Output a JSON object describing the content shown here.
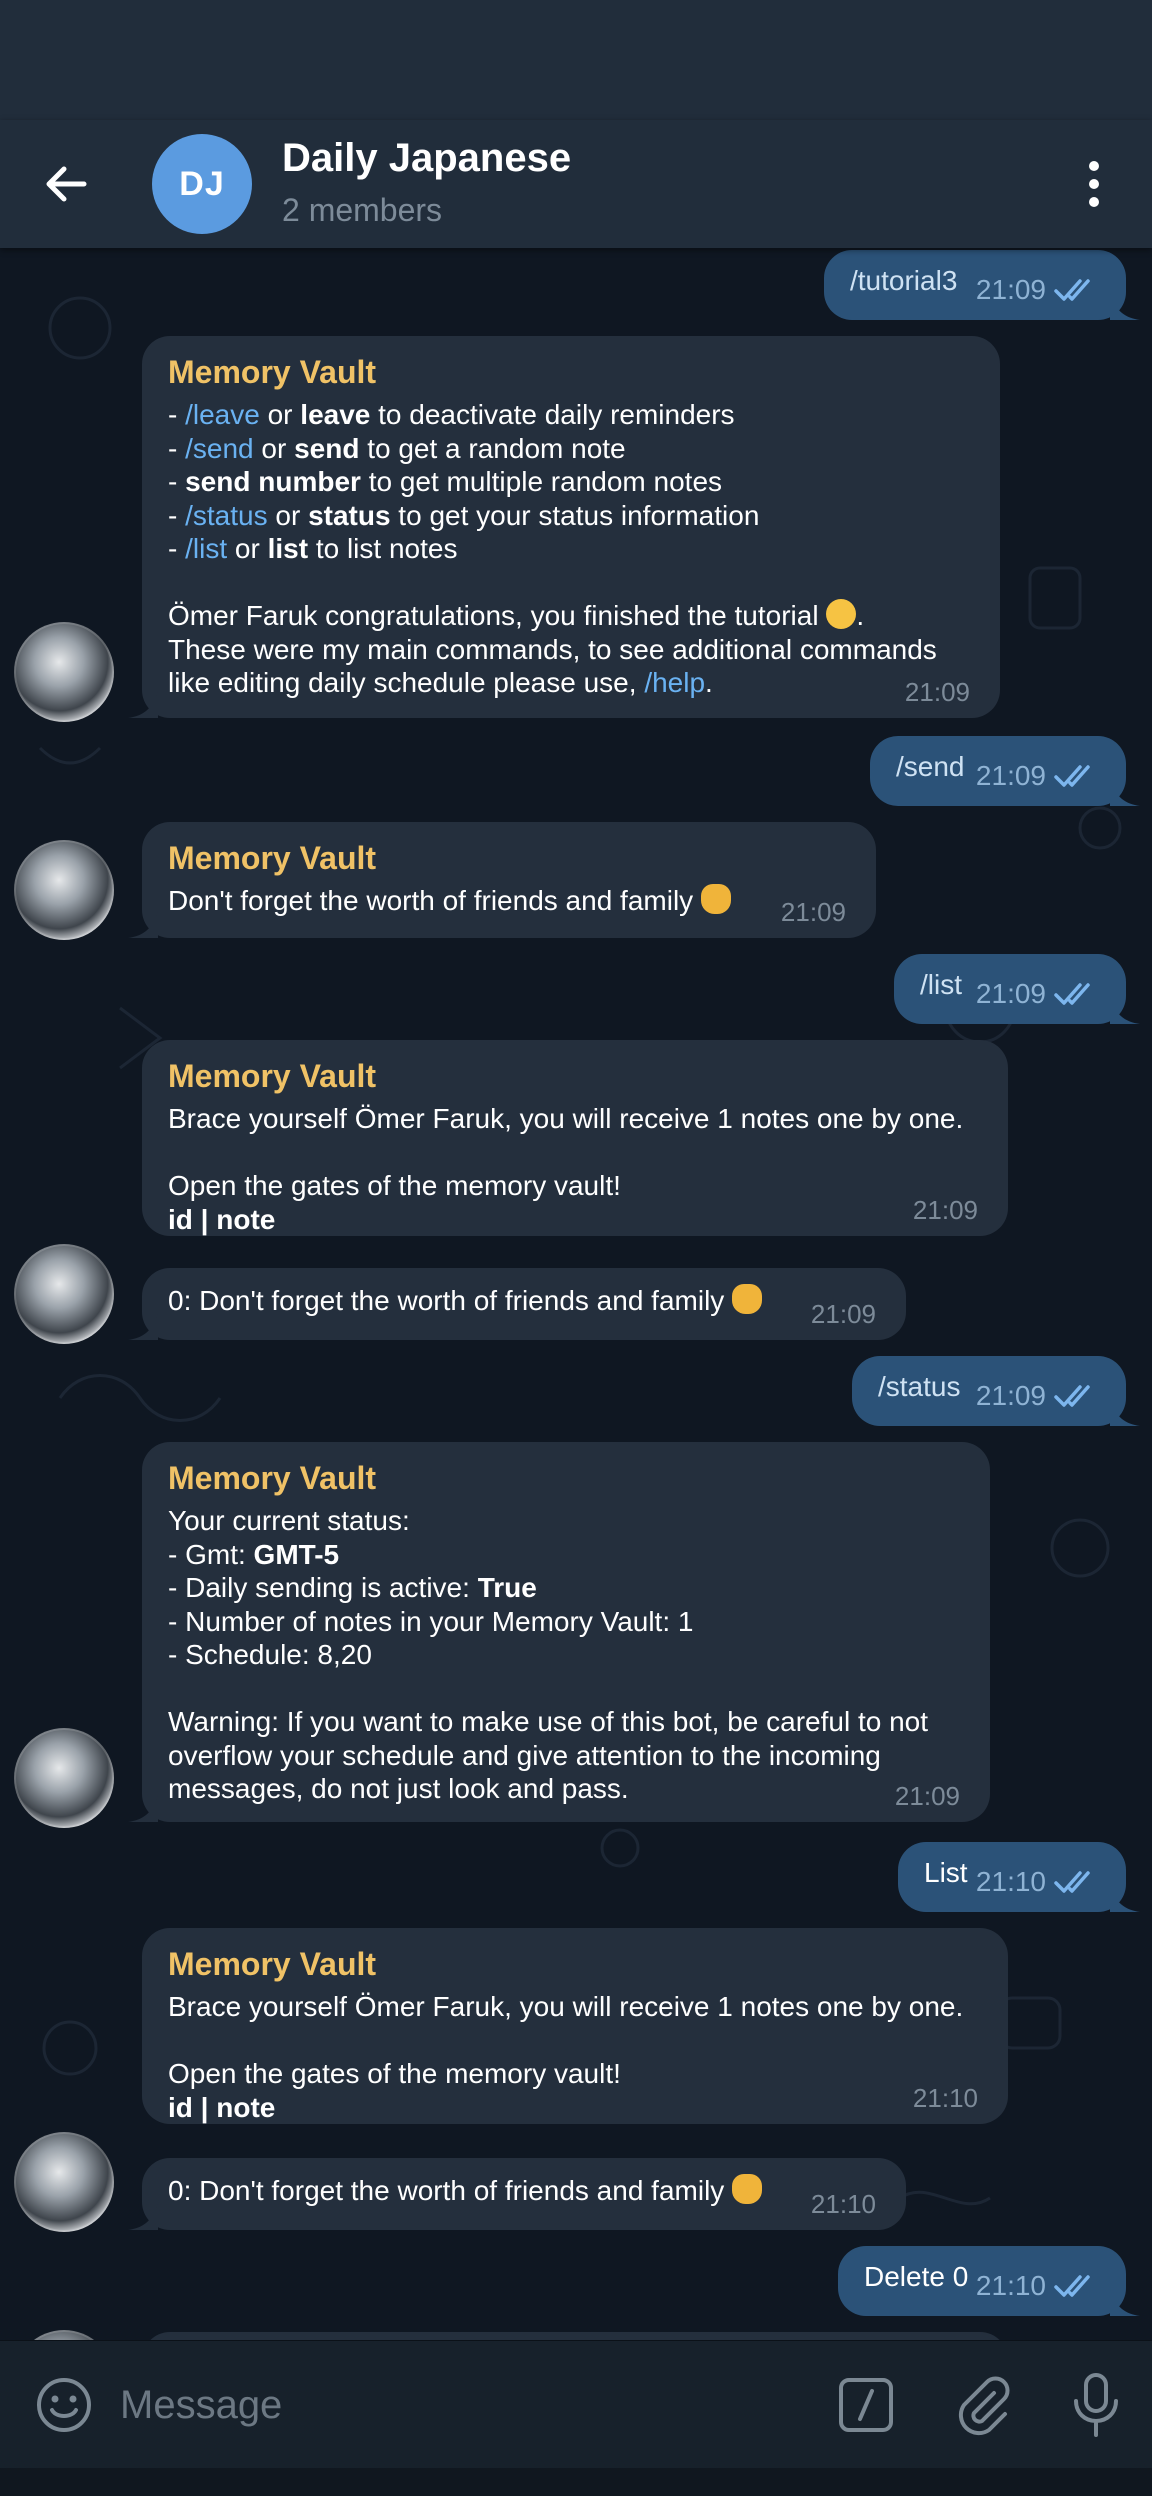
{
  "header": {
    "avatar_initials": "DJ",
    "title": "Daily Japanese",
    "subtitle": "2 members",
    "back_icon": "arrow-left-icon",
    "menu_icon": "more-vertical-icon"
  },
  "messages": [
    {
      "type": "out",
      "text": "/tutorial3",
      "time": "21:09"
    },
    {
      "type": "in",
      "sender": "Memory Vault",
      "time": "21:09",
      "lines": {
        "l1a": "- ",
        "l1b": "/leave",
        "l1c": " or ",
        "l1d": "leave",
        "l1e": " to deactivate daily reminders",
        "l2a": "- ",
        "l2b": "/send",
        "l2c": " or ",
        "l2d": "send",
        "l2e": " to get a random note",
        "l3a": "- ",
        "l3b": "send number",
        "l3c": " to get multiple random notes",
        "l4a": "- ",
        "l4b": "/status",
        "l4c": " or ",
        "l4d": "status",
        "l4e": " to get your status information",
        "l5a": "- ",
        "l5b": "/list",
        "l5c": " or ",
        "l5d": "list",
        "l5e": " to list notes",
        "p2a": "Ömer Faruk congratulations, you finished the tutorial ",
        "p2b": ".",
        "p3a": "These were my main commands, to see additional commands",
        "p3b": "like editing daily schedule please use, ",
        "p3c": "/help",
        "p3d": "."
      }
    },
    {
      "type": "out",
      "text": "/send",
      "time": "21:09"
    },
    {
      "type": "in",
      "sender": "Memory Vault",
      "text": "Don't forget the worth of friends and family ",
      "time": "21:09"
    },
    {
      "type": "out",
      "text": "/list",
      "time": "21:09"
    },
    {
      "type": "in",
      "sender": "Memory Vault",
      "time": "21:09",
      "lines": {
        "a": "Brace yourself Ömer Faruk, you will receive 1 notes one by one.",
        "b": "Open the gates of the memory vault!",
        "c": "id | note"
      }
    },
    {
      "type": "in",
      "text": "0: Don't forget the worth of friends and family ",
      "time": "21:09"
    },
    {
      "type": "out",
      "text": "/status",
      "time": "21:09"
    },
    {
      "type": "in",
      "sender": "Memory Vault",
      "time": "21:09",
      "lines": {
        "a": "Your current status:",
        "b1": "- Gmt: ",
        "b2": "GMT-5",
        "c1": "- Daily sending is active: ",
        "c2": "True",
        "d": "- Number of notes in your Memory Vault: 1",
        "e": "- Schedule: 8,20",
        "f": "Warning: If you want to make use of this bot, be careful to not",
        "g": "overflow your schedule and give attention to the incoming",
        "h": "messages, do not just look and pass."
      }
    },
    {
      "type": "out",
      "text": "List",
      "time": "21:10"
    },
    {
      "type": "in",
      "sender": "Memory Vault",
      "time": "21:10",
      "lines": {
        "a": "Brace yourself Ömer Faruk, you will receive 1 notes one by one.",
        "b": "Open the gates of the memory vault!",
        "c": "id | note"
      }
    },
    {
      "type": "in",
      "text": "0: Don't forget the worth of friends and family ",
      "time": "21:10"
    },
    {
      "type": "out",
      "text": "Delete 0",
      "time": "21:10"
    }
  ],
  "composer": {
    "placeholder": "Message",
    "emoji_icon": "smile-icon",
    "command_icon": "slash-command-icon",
    "attach_icon": "paperclip-icon",
    "mic_icon": "microphone-icon"
  },
  "colors": {
    "background": "#0e1621",
    "header": "#212d3b",
    "incoming_bubble": "#242f3d",
    "outgoing_bubble": "#2b5278",
    "sender_name": "#f0c266",
    "link": "#6ab2f2"
  }
}
